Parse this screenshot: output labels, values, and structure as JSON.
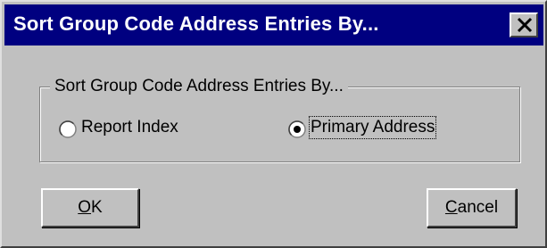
{
  "dialog": {
    "title": "Sort Group Code Address Entries By...",
    "close_icon": "close-icon"
  },
  "group": {
    "legend": "Sort Group Code Address Entries By...",
    "options": [
      {
        "label": "Report Index",
        "selected": false
      },
      {
        "label": "Primary Address",
        "selected": true
      }
    ]
  },
  "buttons": {
    "ok": {
      "mnemonic": "O",
      "rest": "K"
    },
    "cancel": {
      "mnemonic": "C",
      "rest": "ancel"
    }
  },
  "colors": {
    "title_bar": "#000080",
    "face": "#c0c0c0"
  }
}
